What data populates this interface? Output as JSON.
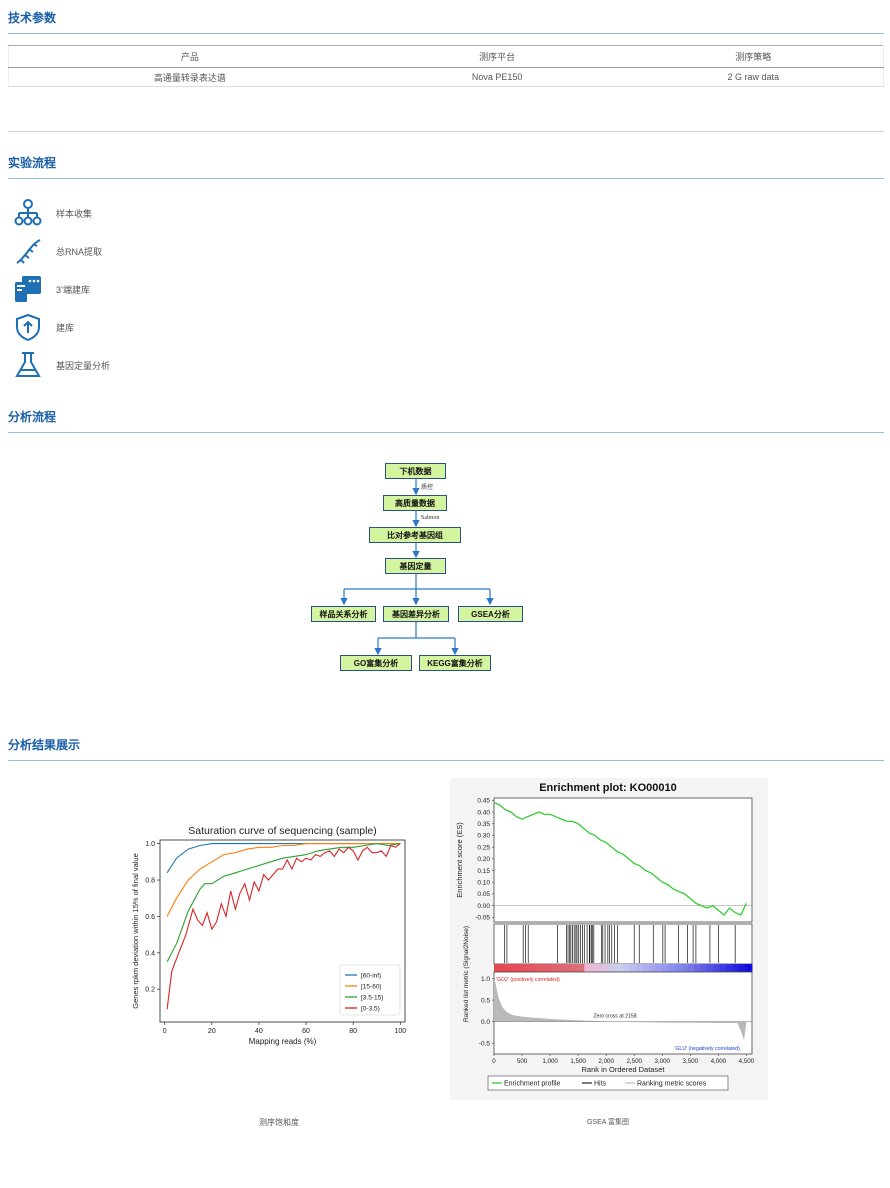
{
  "sections": {
    "tech": "技术参数",
    "workflow": "实验流程",
    "analysis": "分析流程",
    "results": "分析结果展示"
  },
  "params_table": {
    "headers": [
      "产品",
      "测序平台",
      "测序策略"
    ],
    "rows": [
      [
        "高通量转录表达谱",
        "Nova PE150",
        "2 G raw data"
      ]
    ]
  },
  "workflow_steps": [
    {
      "label": "样本收集",
      "icon": "hierarchy-icon"
    },
    {
      "label": "总RNA提取",
      "icon": "dna-icon"
    },
    {
      "label": "3’端建库",
      "icon": "sequencer-icon"
    },
    {
      "label": "建库",
      "icon": "upload-shield-icon"
    },
    {
      "label": "基因定量分析",
      "icon": "flask-icon"
    }
  ],
  "flow": {
    "n1": "下机数据",
    "e1": "质控",
    "n2": "高质量数据",
    "e2": "Salmon",
    "n3": "比对参考基因组",
    "n4": "基因定量",
    "n5a": "样品关系分析",
    "n5b": "基因差异分析",
    "n5c": "GSEA分析",
    "n6a": "GO富集分析",
    "n6b": "KEGG富集分析"
  },
  "captions": {
    "left": "测序饱和度",
    "right": "GSEA 富集图"
  },
  "chart_data": [
    {
      "type": "line",
      "title": "Saturation curve of sequencing (sample)",
      "xlabel": "Mapping reads (%)",
      "ylabel": "Genes rpkm deviation within 15% of final value",
      "xlim": [
        -2,
        102
      ],
      "ylim": [
        0.02,
        1.02
      ],
      "xticks": [
        0,
        20,
        40,
        60,
        80,
        100
      ],
      "yticks": [
        0.2,
        0.4,
        0.6,
        0.8,
        1.0
      ],
      "legend": "bottom-right",
      "series": [
        {
          "name": "[60-inf)",
          "color": "#1f77b4",
          "x": [
            1,
            5,
            10,
            15,
            20,
            25,
            30,
            40,
            50,
            60,
            70,
            80,
            90,
            100
          ],
          "y": [
            0.84,
            0.92,
            0.97,
            0.99,
            1.0,
            1.0,
            1.0,
            1.0,
            1.0,
            1.0,
            1.0,
            1.0,
            1.0,
            1.0
          ]
        },
        {
          "name": "[15-60)",
          "color": "#ff7f0e",
          "x": [
            1,
            5,
            10,
            15,
            20,
            25,
            30,
            35,
            40,
            45,
            50,
            55,
            60,
            65,
            70,
            80,
            90,
            100
          ],
          "y": [
            0.6,
            0.7,
            0.8,
            0.86,
            0.9,
            0.94,
            0.95,
            0.97,
            0.98,
            0.98,
            0.99,
            0.99,
            1.0,
            1.0,
            1.0,
            1.0,
            1.0,
            1.0
          ],
          "note": ""
        },
        {
          "name": "[3.5-15)",
          "color": "#2ca02c",
          "x": [
            1,
            5,
            10,
            15,
            17,
            20,
            25,
            30,
            35,
            40,
            45,
            50,
            55,
            60,
            65,
            70,
            75,
            80,
            85,
            90,
            95,
            100
          ],
          "y": [
            0.35,
            0.45,
            0.63,
            0.75,
            0.78,
            0.78,
            0.82,
            0.84,
            0.86,
            0.88,
            0.9,
            0.92,
            0.93,
            0.94,
            0.96,
            0.97,
            0.98,
            0.98,
            0.99,
            1.0,
            0.99,
            1.0
          ]
        },
        {
          "name": "[0-3.5)",
          "color": "#d62728",
          "x": [
            1,
            3,
            6,
            9,
            12,
            14,
            16,
            18,
            20,
            22,
            24,
            26,
            28,
            30,
            32,
            34,
            36,
            38,
            40,
            42,
            44,
            46,
            48,
            50,
            52,
            54,
            56,
            58,
            60,
            62,
            64,
            66,
            68,
            70,
            72,
            74,
            76,
            78,
            80,
            82,
            84,
            86,
            88,
            90,
            92,
            94,
            96,
            98,
            100
          ],
          "y": [
            0.09,
            0.3,
            0.4,
            0.5,
            0.64,
            0.58,
            0.55,
            0.62,
            0.53,
            0.57,
            0.67,
            0.6,
            0.74,
            0.64,
            0.73,
            0.78,
            0.69,
            0.79,
            0.74,
            0.83,
            0.8,
            0.83,
            0.86,
            0.86,
            0.91,
            0.86,
            0.92,
            0.9,
            0.92,
            0.91,
            0.94,
            0.93,
            0.95,
            0.96,
            0.93,
            0.97,
            0.95,
            0.98,
            0.96,
            0.91,
            0.96,
            0.98,
            0.95,
            0.95,
            0.96,
            0.93,
            0.99,
            0.98,
            1.0
          ]
        }
      ]
    },
    {
      "type": "line",
      "title": "Enrichment plot: KO00010",
      "ylabel": "Enrichment score (ES)",
      "xlabel": "Rank in Ordered Dataset",
      "ylabel2": "Ranked list metric (Signal2Noise)",
      "xlim": [
        0,
        4600
      ],
      "ylim": [
        -0.07,
        0.46
      ],
      "xticks": [
        0,
        500,
        1000,
        1500,
        2000,
        2500,
        3000,
        3500,
        4000,
        4500
      ],
      "xticklabels": [
        "0",
        "500",
        "1,000",
        "1,500",
        "2,000",
        "2,500",
        "3,000",
        "3,500",
        "4,000",
        "4,500"
      ],
      "yticks": [
        -0.05,
        0.0,
        0.05,
        0.1,
        0.15,
        0.2,
        0.25,
        0.3,
        0.35,
        0.4,
        0.45
      ],
      "yticklabels": [
        "-0.05",
        "0.00",
        "0.05",
        "0.10",
        "0.15",
        "0.20",
        "0.25",
        "0.30",
        "0.35",
        "0.40",
        "0.45"
      ],
      "metric_yticks": [
        1.0,
        0.5,
        0.0,
        -0.5
      ],
      "metric_yticklabels": [
        "1.0",
        "0.5",
        "0.0",
        "-0.5"
      ],
      "series": [
        {
          "name": "Enrichment profile",
          "color": "#33cc33",
          "x": [
            0,
            100,
            200,
            300,
            400,
            500,
            600,
            700,
            800,
            900,
            1000,
            1100,
            1200,
            1300,
            1400,
            1500,
            1600,
            1700,
            1800,
            1900,
            2000,
            2100,
            2200,
            2300,
            2400,
            2500,
            2600,
            2700,
            2800,
            2900,
            3000,
            3100,
            3200,
            3300,
            3400,
            3500,
            3600,
            3700,
            3800,
            3900,
            4000,
            4100,
            4200,
            4300,
            4400,
            4500
          ],
          "y": [
            0.44,
            0.43,
            0.41,
            0.4,
            0.38,
            0.37,
            0.38,
            0.39,
            0.4,
            0.39,
            0.39,
            0.38,
            0.37,
            0.36,
            0.36,
            0.35,
            0.33,
            0.31,
            0.3,
            0.28,
            0.27,
            0.25,
            0.23,
            0.22,
            0.2,
            0.18,
            0.17,
            0.15,
            0.14,
            0.12,
            0.1,
            0.09,
            0.07,
            0.06,
            0.05,
            0.03,
            0.01,
            0.0,
            -0.01,
            0.0,
            -0.02,
            -0.04,
            -0.01,
            -0.03,
            -0.04,
            0.01
          ]
        }
      ],
      "hits": [
        190,
        230,
        520,
        560,
        610,
        1130,
        1290,
        1320,
        1350,
        1370,
        1400,
        1430,
        1460,
        1480,
        1510,
        1540,
        1580,
        1610,
        1660,
        1700,
        1710,
        1740,
        1760,
        1780,
        1920,
        1940,
        1980,
        2030,
        2060,
        2100,
        2150,
        2200,
        2500,
        2590,
        2840,
        3010,
        3050,
        3290,
        3450,
        3550,
        3600,
        3850,
        4000,
        4300
      ],
      "labels": {
        "pos": "'GO2' (positively correlated)",
        "neg": "'GLU' (negatively correlated)",
        "zero": "Zero cross at 2158"
      },
      "legend": {
        "profile": "Enrichment profile",
        "hits": "Hits",
        "metric": "Ranking metric scores"
      }
    }
  ]
}
